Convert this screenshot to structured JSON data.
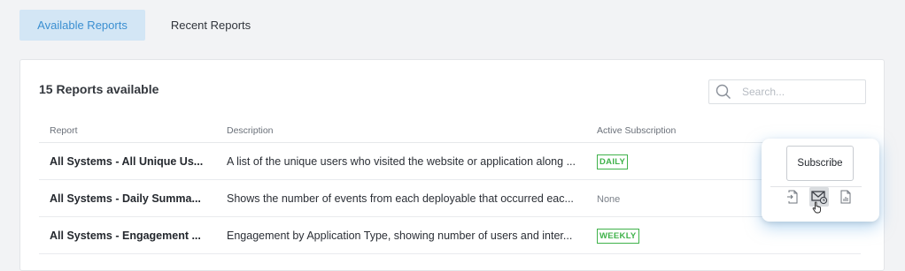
{
  "tabs": [
    {
      "label": "Available Reports",
      "active": true
    },
    {
      "label": "Recent Reports",
      "active": false
    }
  ],
  "card": {
    "title": "15 Reports available",
    "search_placeholder": "Search..."
  },
  "table": {
    "headers": [
      "Report",
      "Description",
      "Active Subscription"
    ],
    "rows": [
      {
        "report": "All Systems - All Unique Us...",
        "description": "A list of the unique users who visited the website or application along ...",
        "subscription": "DAILY"
      },
      {
        "report": "All Systems - Daily Summa...",
        "description": "Shows the number of events from each deployable that occurred eac...",
        "subscription": "None"
      },
      {
        "report": "All Systems - Engagement ...",
        "description": "Engagement by Application Type, showing number of users and inter...",
        "subscription": "WEEKLY"
      }
    ]
  },
  "popover": {
    "tooltip": "Subscribe",
    "actions": [
      "export-icon",
      "subscribe-mail-icon",
      "report-chart-icon"
    ]
  },
  "colors": {
    "accent": "#3b8fd1",
    "tab_active_bg": "#d3e6f5",
    "badge_green": "#3fb24a"
  }
}
